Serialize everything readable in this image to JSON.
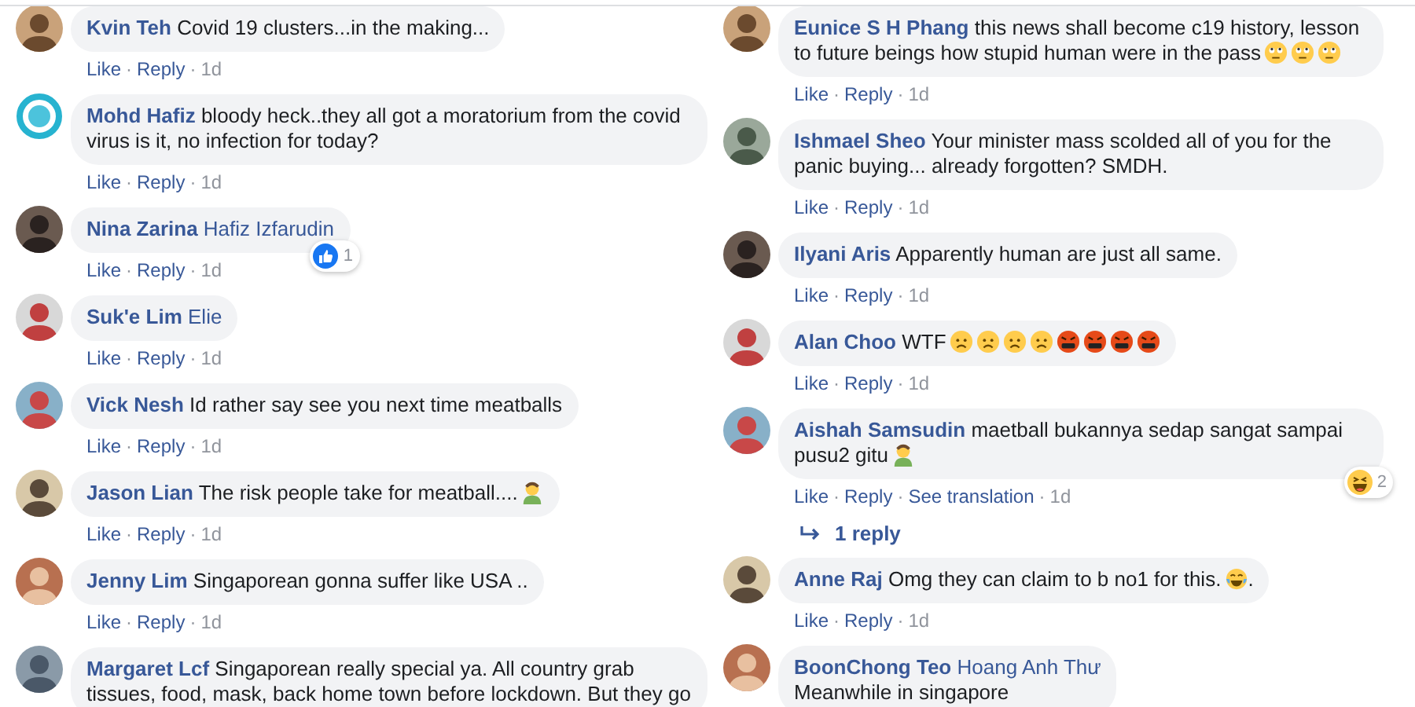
{
  "columns": [
    {
      "comments": [
        {
          "name": "Kvin Teh",
          "text": "Covid 19 clusters...in the making...",
          "avatar": {
            "kind": "photo"
          },
          "actions": [
            {
              "label": "Like",
              "kind": "link"
            },
            {
              "label": "·",
              "kind": "sep"
            },
            {
              "label": "Reply",
              "kind": "link"
            },
            {
              "label": "·",
              "kind": "sep"
            },
            {
              "label": "1d",
              "kind": "time"
            }
          ]
        },
        {
          "name": "Mohd Hafiz",
          "text": "bloody heck..they all got a moratorium from the covid virus is it, no infection for today?",
          "avatar": {
            "kind": "logo"
          },
          "actions": [
            {
              "label": "Like",
              "kind": "link"
            },
            {
              "label": "·",
              "kind": "sep"
            },
            {
              "label": "Reply",
              "kind": "link"
            },
            {
              "label": "·",
              "kind": "sep"
            },
            {
              "label": "1d",
              "kind": "time"
            }
          ]
        },
        {
          "name": "Nina Zarina",
          "tag": "Hafiz Izfarudin",
          "avatar": {
            "kind": "photo"
          },
          "reaction": {
            "kind": "like",
            "count": "1"
          },
          "actions": [
            {
              "label": "Like",
              "kind": "link"
            },
            {
              "label": "·",
              "kind": "sep"
            },
            {
              "label": "Reply",
              "kind": "link"
            },
            {
              "label": "·",
              "kind": "sep"
            },
            {
              "label": "1d",
              "kind": "time"
            }
          ]
        },
        {
          "name": "Suk'e Lim",
          "tag": "Elie",
          "avatar": {
            "kind": "photo"
          },
          "actions": [
            {
              "label": "Like",
              "kind": "link"
            },
            {
              "label": "·",
              "kind": "sep"
            },
            {
              "label": "Reply",
              "kind": "link"
            },
            {
              "label": "·",
              "kind": "sep"
            },
            {
              "label": "1d",
              "kind": "time"
            }
          ]
        },
        {
          "name": "Vick Nesh",
          "text": "Id rather say see you next time meatballs",
          "avatar": {
            "kind": "photo"
          },
          "actions": [
            {
              "label": "Like",
              "kind": "link"
            },
            {
              "label": "·",
              "kind": "sep"
            },
            {
              "label": "Reply",
              "kind": "link"
            },
            {
              "label": "·",
              "kind": "sep"
            },
            {
              "label": "1d",
              "kind": "time"
            }
          ]
        },
        {
          "name": "Jason Lian",
          "text": "The risk people take for meatball....",
          "emojis": [
            {
              "kind": "facepalm"
            }
          ],
          "avatar": {
            "kind": "photo"
          },
          "actions": [
            {
              "label": "Like",
              "kind": "link"
            },
            {
              "label": "·",
              "kind": "sep"
            },
            {
              "label": "Reply",
              "kind": "link"
            },
            {
              "label": "·",
              "kind": "sep"
            },
            {
              "label": "1d",
              "kind": "time"
            }
          ]
        },
        {
          "name": "Jenny Lim",
          "text": "Singaporean gonna suffer like USA ..",
          "avatar": {
            "kind": "photo"
          },
          "actions": [
            {
              "label": "Like",
              "kind": "link"
            },
            {
              "label": "·",
              "kind": "sep"
            },
            {
              "label": "Reply",
              "kind": "link"
            },
            {
              "label": "·",
              "kind": "sep"
            },
            {
              "label": "1d",
              "kind": "time"
            }
          ]
        },
        {
          "name": "Margaret Lcf",
          "text": "Singaporean really special ya. All country grab tissues, food, mask, back home town before lockdown. But they go",
          "avatar": {
            "kind": "photo"
          }
        }
      ]
    },
    {
      "comments": [
        {
          "name": "Eunice S H Phang",
          "text": "this news shall become c19 history, lesson to future beings how stupid human were in the pass",
          "emojis": [
            {
              "kind": "rolling-eyes"
            },
            {
              "kind": "rolling-eyes"
            },
            {
              "kind": "rolling-eyes"
            }
          ],
          "avatar": {
            "kind": "photo"
          },
          "actions": [
            {
              "label": "Like",
              "kind": "link"
            },
            {
              "label": "·",
              "kind": "sep"
            },
            {
              "label": "Reply",
              "kind": "link"
            },
            {
              "label": "·",
              "kind": "sep"
            },
            {
              "label": "1d",
              "kind": "time"
            }
          ]
        },
        {
          "name": "Ishmael Sheo",
          "text": "Your minister mass scolded all of you for the panic buying... already forgotten? SMDH.",
          "avatar": {
            "kind": "photo"
          },
          "actions": [
            {
              "label": "Like",
              "kind": "link"
            },
            {
              "label": "·",
              "kind": "sep"
            },
            {
              "label": "Reply",
              "kind": "link"
            },
            {
              "label": "·",
              "kind": "sep"
            },
            {
              "label": "1d",
              "kind": "time"
            }
          ]
        },
        {
          "name": "Ilyani Aris",
          "text": "Apparently human are just all same.",
          "avatar": {
            "kind": "photo"
          },
          "actions": [
            {
              "label": "Like",
              "kind": "link"
            },
            {
              "label": "·",
              "kind": "sep"
            },
            {
              "label": "Reply",
              "kind": "link"
            },
            {
              "label": "·",
              "kind": "sep"
            },
            {
              "label": "1d",
              "kind": "time"
            }
          ]
        },
        {
          "name": "Alan Choo",
          "text": "WTF",
          "emojis": [
            {
              "kind": "frowning"
            },
            {
              "kind": "frowning"
            },
            {
              "kind": "frowning"
            },
            {
              "kind": "frowning"
            },
            {
              "kind": "cursing"
            },
            {
              "kind": "cursing"
            },
            {
              "kind": "cursing"
            },
            {
              "kind": "cursing"
            }
          ],
          "avatar": {
            "kind": "photo"
          },
          "actions": [
            {
              "label": "Like",
              "kind": "link"
            },
            {
              "label": "·",
              "kind": "sep"
            },
            {
              "label": "Reply",
              "kind": "link"
            },
            {
              "label": "·",
              "kind": "sep"
            },
            {
              "label": "1d",
              "kind": "time"
            }
          ]
        },
        {
          "name": "Aishah Samsudin",
          "text": "maetball bukannya sedap sangat sampai pusu2 gitu",
          "emojis": [
            {
              "kind": "facepalm"
            }
          ],
          "avatar": {
            "kind": "photo"
          },
          "reaction": {
            "kind": "haha",
            "count": "2"
          },
          "actions": [
            {
              "label": "Like",
              "kind": "link"
            },
            {
              "label": "·",
              "kind": "sep"
            },
            {
              "label": "Reply",
              "kind": "link"
            },
            {
              "label": "·",
              "kind": "sep"
            },
            {
              "label": "See translation",
              "kind": "link"
            },
            {
              "label": "·",
              "kind": "sep"
            },
            {
              "label": "1d",
              "kind": "time"
            }
          ],
          "replies": "1 reply"
        },
        {
          "name": "Anne Raj",
          "text": "Omg they can claim to b no1 for this.",
          "emojis": [
            {
              "kind": "tears-of-joy"
            }
          ],
          "text_after": ".",
          "avatar": {
            "kind": "photo"
          },
          "actions": [
            {
              "label": "Like",
              "kind": "link"
            },
            {
              "label": "·",
              "kind": "sep"
            },
            {
              "label": "Reply",
              "kind": "link"
            },
            {
              "label": "·",
              "kind": "sep"
            },
            {
              "label": "1d",
              "kind": "time"
            }
          ]
        },
        {
          "name": "BoonChong Teo",
          "tag": "Hoang Anh Thư",
          "text": "Meanwhile in singapore",
          "break": true,
          "avatar": {
            "kind": "photo"
          }
        }
      ]
    }
  ]
}
